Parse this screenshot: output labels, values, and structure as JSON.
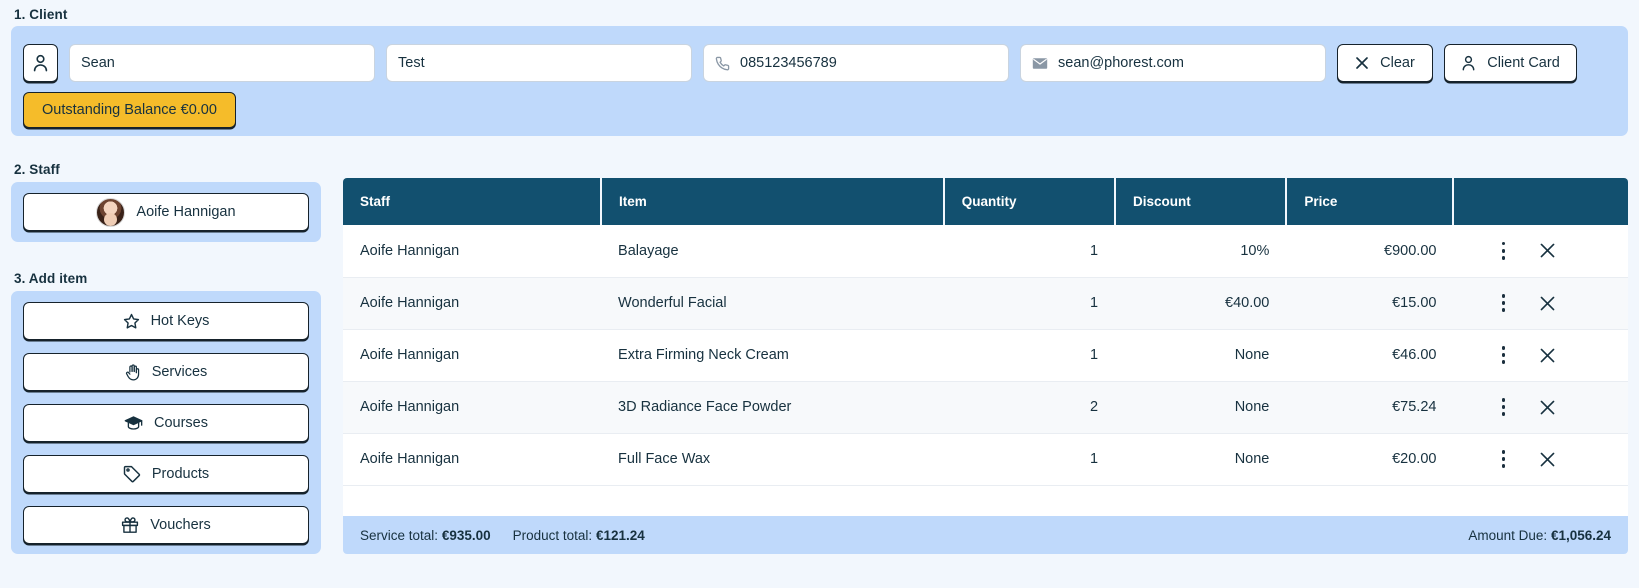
{
  "sections": {
    "client_label": "1. Client",
    "staff_label": "2. Staff",
    "add_item_label": "3. Add item"
  },
  "client": {
    "first_name": "Sean",
    "last_name": "Test",
    "phone": "085123456789",
    "email": "sean@phorest.com",
    "clear_label": "Clear",
    "client_card_label": "Client Card",
    "outstanding_balance_label": "Outstanding Balance €0.00"
  },
  "staff": {
    "selected": "Aoife Hannigan"
  },
  "add_item": {
    "buttons": [
      {
        "label": "Hot Keys",
        "icon": "star-icon"
      },
      {
        "label": "Services",
        "icon": "hand-icon"
      },
      {
        "label": "Courses",
        "icon": "graduation-cap-icon"
      },
      {
        "label": "Products",
        "icon": "tag-icon"
      },
      {
        "label": "Vouchers",
        "icon": "gift-icon"
      }
    ]
  },
  "table": {
    "columns": [
      "Staff",
      "Item",
      "Quantity",
      "Discount",
      "Price",
      ""
    ],
    "rows": [
      {
        "staff": "Aoife Hannigan",
        "item": "Balayage",
        "quantity": "1",
        "discount": "10%",
        "price": "€900.00"
      },
      {
        "staff": "Aoife Hannigan",
        "item": "Wonderful Facial",
        "quantity": "1",
        "discount": "€40.00",
        "price": "€15.00"
      },
      {
        "staff": "Aoife Hannigan",
        "item": "Extra Firming Neck Cream",
        "quantity": "1",
        "discount": "None",
        "price": "€46.00"
      },
      {
        "staff": "Aoife Hannigan",
        "item": "3D Radiance Face Powder",
        "quantity": "2",
        "discount": "None",
        "price": "€75.24"
      },
      {
        "staff": "Aoife Hannigan",
        "item": "Full Face Wax",
        "quantity": "1",
        "discount": "None",
        "price": "€20.00"
      }
    ],
    "footer": {
      "service_total_label": "Service total:",
      "service_total_value": "€935.00",
      "product_total_label": "Product total:",
      "product_total_value": "€121.24",
      "amount_due_label": "Amount Due:",
      "amount_due_value": "€1,056.24"
    }
  },
  "colors": {
    "page_bg": "#f2f7fd",
    "panel_blue": "#bfd9fb",
    "table_header": "#12506f",
    "accent_yellow": "#f5bc2a",
    "text": "#17313f"
  }
}
